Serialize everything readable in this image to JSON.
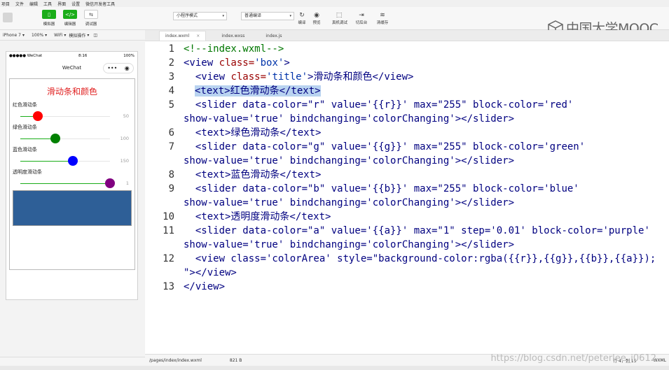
{
  "menu": [
    "项目",
    "文件",
    "编辑",
    "工具",
    "界面",
    "设置",
    "微信开发者工具"
  ],
  "toolbar": {
    "simulator_label": "模拟器",
    "editor_label": "编辑器",
    "debugger_label": "调试器",
    "mode_select": "小程序模式",
    "compile_select": "普通编译",
    "compile_label": "编译",
    "preview_label": "预览",
    "real_debug_label": "真机调试",
    "background_label": "切后台",
    "clear_cache_label": "清缓存"
  },
  "logo_text": "中国大学MOOC",
  "device_bar": {
    "device": "iPhone 7",
    "zoom": "100%",
    "network": "WiFi",
    "simulate": "模拟操作"
  },
  "phone": {
    "carrier": "●●●●● WeChat",
    "time": "8:16",
    "battery": "100%",
    "nav_title": "WeChat",
    "capsule_more": "•••",
    "page_title": "滑动条和颜色",
    "sliders": [
      {
        "label": "红色滑动条",
        "value": "50",
        "fraction": 0.196,
        "color": "red",
        "fill": "#1aad19"
      },
      {
        "label": "绿色滑动条",
        "value": "100",
        "fraction": 0.392,
        "color": "green",
        "fill": "#1aad19"
      },
      {
        "label": "蓝色滑动条",
        "value": "150",
        "fraction": 0.588,
        "color": "blue",
        "fill": "#1aad19"
      },
      {
        "label": "透明度滑动条",
        "value": "1",
        "fraction": 1.0,
        "color": "purple",
        "fill": "#1aad19"
      }
    ],
    "color_area": "#2e5f97"
  },
  "tabs": [
    {
      "label": "index.wxml",
      "active": true
    },
    {
      "label": "index.wxss",
      "active": false
    },
    {
      "label": "index.js",
      "active": false
    }
  ],
  "code": {
    "line_numbers": [
      "1",
      "2",
      "3",
      "4",
      "5",
      "6",
      "7",
      "8",
      "9",
      "10",
      "11",
      "12",
      "13"
    ],
    "l1": "<!--index.wxml-->",
    "l2_tag": "<view ",
    "l2_attr": "class=",
    "l2_val": "'box'",
    "l2_end": ">",
    "l3_tag": "  <view ",
    "l3_attr": "class=",
    "l3_val": "'title'",
    "l3_text": ">滑动条和颜色</view>",
    "l4": "<text>红色滑动条</text>",
    "l5a": "  <slider data-color=\"r\" value='{{r}}' max=\"255\" block-color='red'",
    "l5b": "show-value='true' bindchanging='colorChanging'></slider>",
    "l6": "  <text>绿色滑动条</text>",
    "l7a": "  <slider data-color=\"g\" value='{{g}}' max=\"255\" block-color='green'",
    "l7b": "show-value='true' bindchanging='colorChanging'></slider>",
    "l8": "  <text>蓝色滑动条</text>",
    "l9a": "  <slider data-color=\"b\" value='{{b}}' max=\"255\" block-color='blue'",
    "l9b": "show-value='true' bindchanging='colorChanging'></slider>",
    "l10": "  <text>透明度滑动条</text>",
    "l11a": "  <slider data-color=\"a\" value='{{a}}' max=\"1\" step='0.01' block-color='purple'",
    "l11b": "show-value='true' bindchanging='colorChanging'></slider>",
    "l12a": "  <view class='colorArea' style=\"background-color:rgba({{r}},{{g}},{{b}},{{a}});",
    "l12b": "\"></view>",
    "l13": "</view>"
  },
  "status": {
    "path": "/pages/index/index.wxml",
    "size": "821 B",
    "position": "行 4，列 15",
    "lang": "WXML"
  },
  "watermark": "https://blog.csdn.net/peterlee_i0612"
}
